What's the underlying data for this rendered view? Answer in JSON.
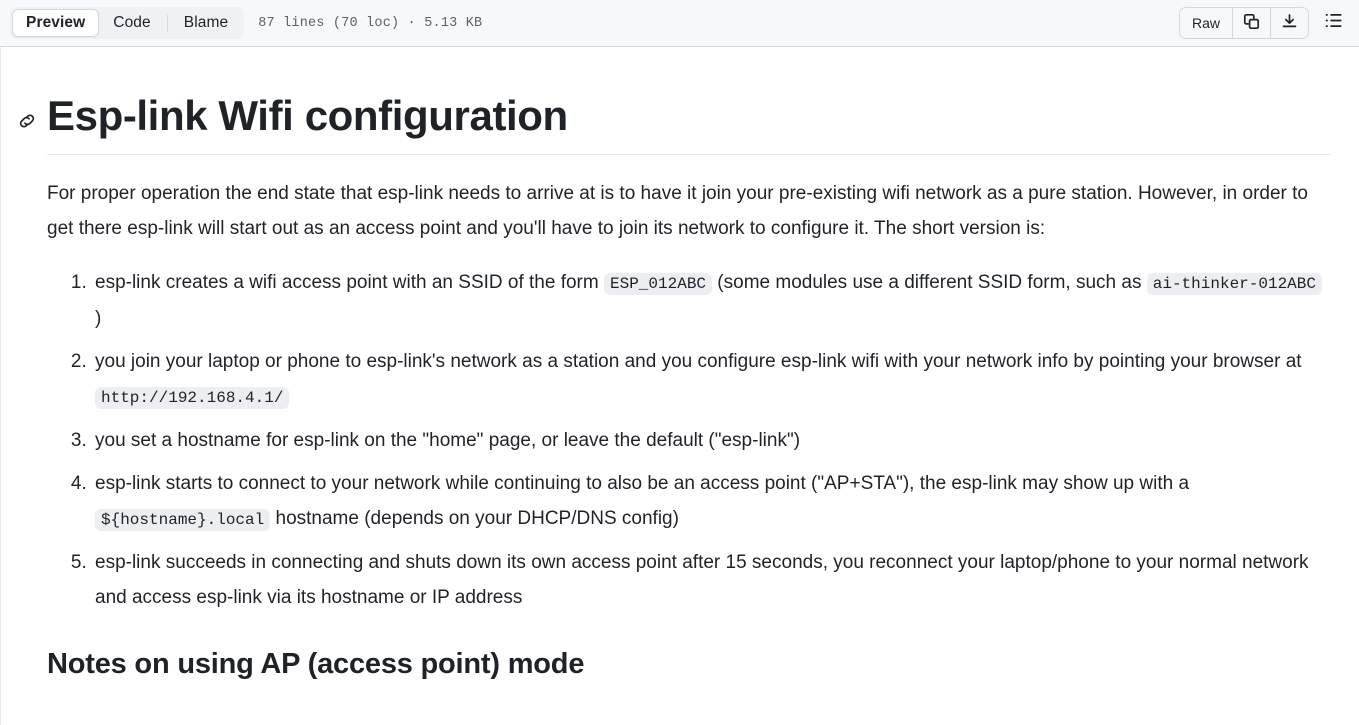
{
  "toolbar": {
    "tabs": [
      {
        "label": "Preview",
        "active": true
      },
      {
        "label": "Code",
        "active": false
      },
      {
        "label": "Blame",
        "active": false
      }
    ],
    "file_meta": "87 lines (70 loc) · 5.13 KB",
    "raw_label": "Raw",
    "copy_icon": "copy-icon",
    "download_icon": "download-icon",
    "outline_icon": "list-outline-icon",
    "background": "#f6f8fa",
    "border_color": "#d1d9e0"
  },
  "document": {
    "anchor_icon": "link-anchor-icon",
    "title": "Esp-link Wifi configuration",
    "intro": "For proper operation the end state that esp-link needs to arrive at is to have it join your pre-existing wifi network as a pure station. However, in order to get there esp-link will start out as an access point and you'll have to join its network to configure it. The short version is:",
    "steps": [
      {
        "n": 1,
        "parts": [
          {
            "t": "text",
            "v": "esp-link creates a wifi access point with an SSID of the form "
          },
          {
            "t": "code",
            "v": "ESP_012ABC"
          },
          {
            "t": "text",
            "v": " (some modules use a different SSID form, such as "
          },
          {
            "t": "code",
            "v": "ai-thinker-012ABC"
          },
          {
            "t": "text",
            "v": " )"
          }
        ]
      },
      {
        "n": 2,
        "parts": [
          {
            "t": "text",
            "v": "you join your laptop or phone to esp-link's network as a station and you configure esp-link wifi with your network info by pointing your browser at "
          },
          {
            "t": "code",
            "v": "http://192.168.4.1/"
          }
        ]
      },
      {
        "n": 3,
        "parts": [
          {
            "t": "text",
            "v": "you set a hostname for esp-link on the \"home\" page, or leave the default (\"esp-link\")"
          }
        ]
      },
      {
        "n": 4,
        "parts": [
          {
            "t": "text",
            "v": "esp-link starts to connect to your network while continuing to also be an access point (\"AP+STA\"), the esp-link may show up with a "
          },
          {
            "t": "code",
            "v": "${hostname}.local"
          },
          {
            "t": "text",
            "v": " hostname (depends on your DHCP/DNS config)"
          }
        ]
      },
      {
        "n": 5,
        "parts": [
          {
            "t": "text",
            "v": "esp-link succeeds in connecting and shuts down its own access point after 15 seconds, you reconnect your laptop/phone to your normal network and access esp-link via its hostname or IP address"
          }
        ]
      }
    ],
    "section_heading": "Notes on using AP (access point) mode",
    "code_bg": "#eceef1",
    "text_color": "#1f2328"
  }
}
